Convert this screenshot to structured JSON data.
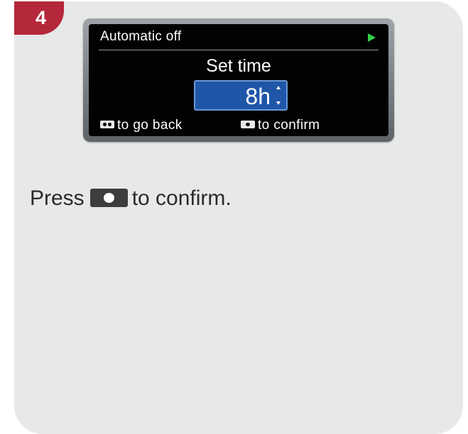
{
  "step": {
    "number": "4",
    "badge_color": "#b5273a"
  },
  "device_screen": {
    "title": "Automatic off",
    "title_icon": "play-icon",
    "prompt": "Set time",
    "value": "8h",
    "value_icons": [
      "arrow-up-icon",
      "arrow-down-icon"
    ],
    "hints": {
      "back_icon": "dual-dot-button-icon",
      "back_text": "to go back",
      "confirm_icon": "single-dot-button-icon",
      "confirm_text": "to confirm"
    },
    "colors": {
      "screen_bg": "#020202",
      "selection_bg": "#1f56a8",
      "indicator": "#2fd14a"
    }
  },
  "instruction": {
    "before": "Press",
    "icon": "confirm-button-icon",
    "after": "to confirm."
  },
  "colors": {
    "card_bg": "#e7e8e8",
    "text": "#2b2b2b"
  }
}
